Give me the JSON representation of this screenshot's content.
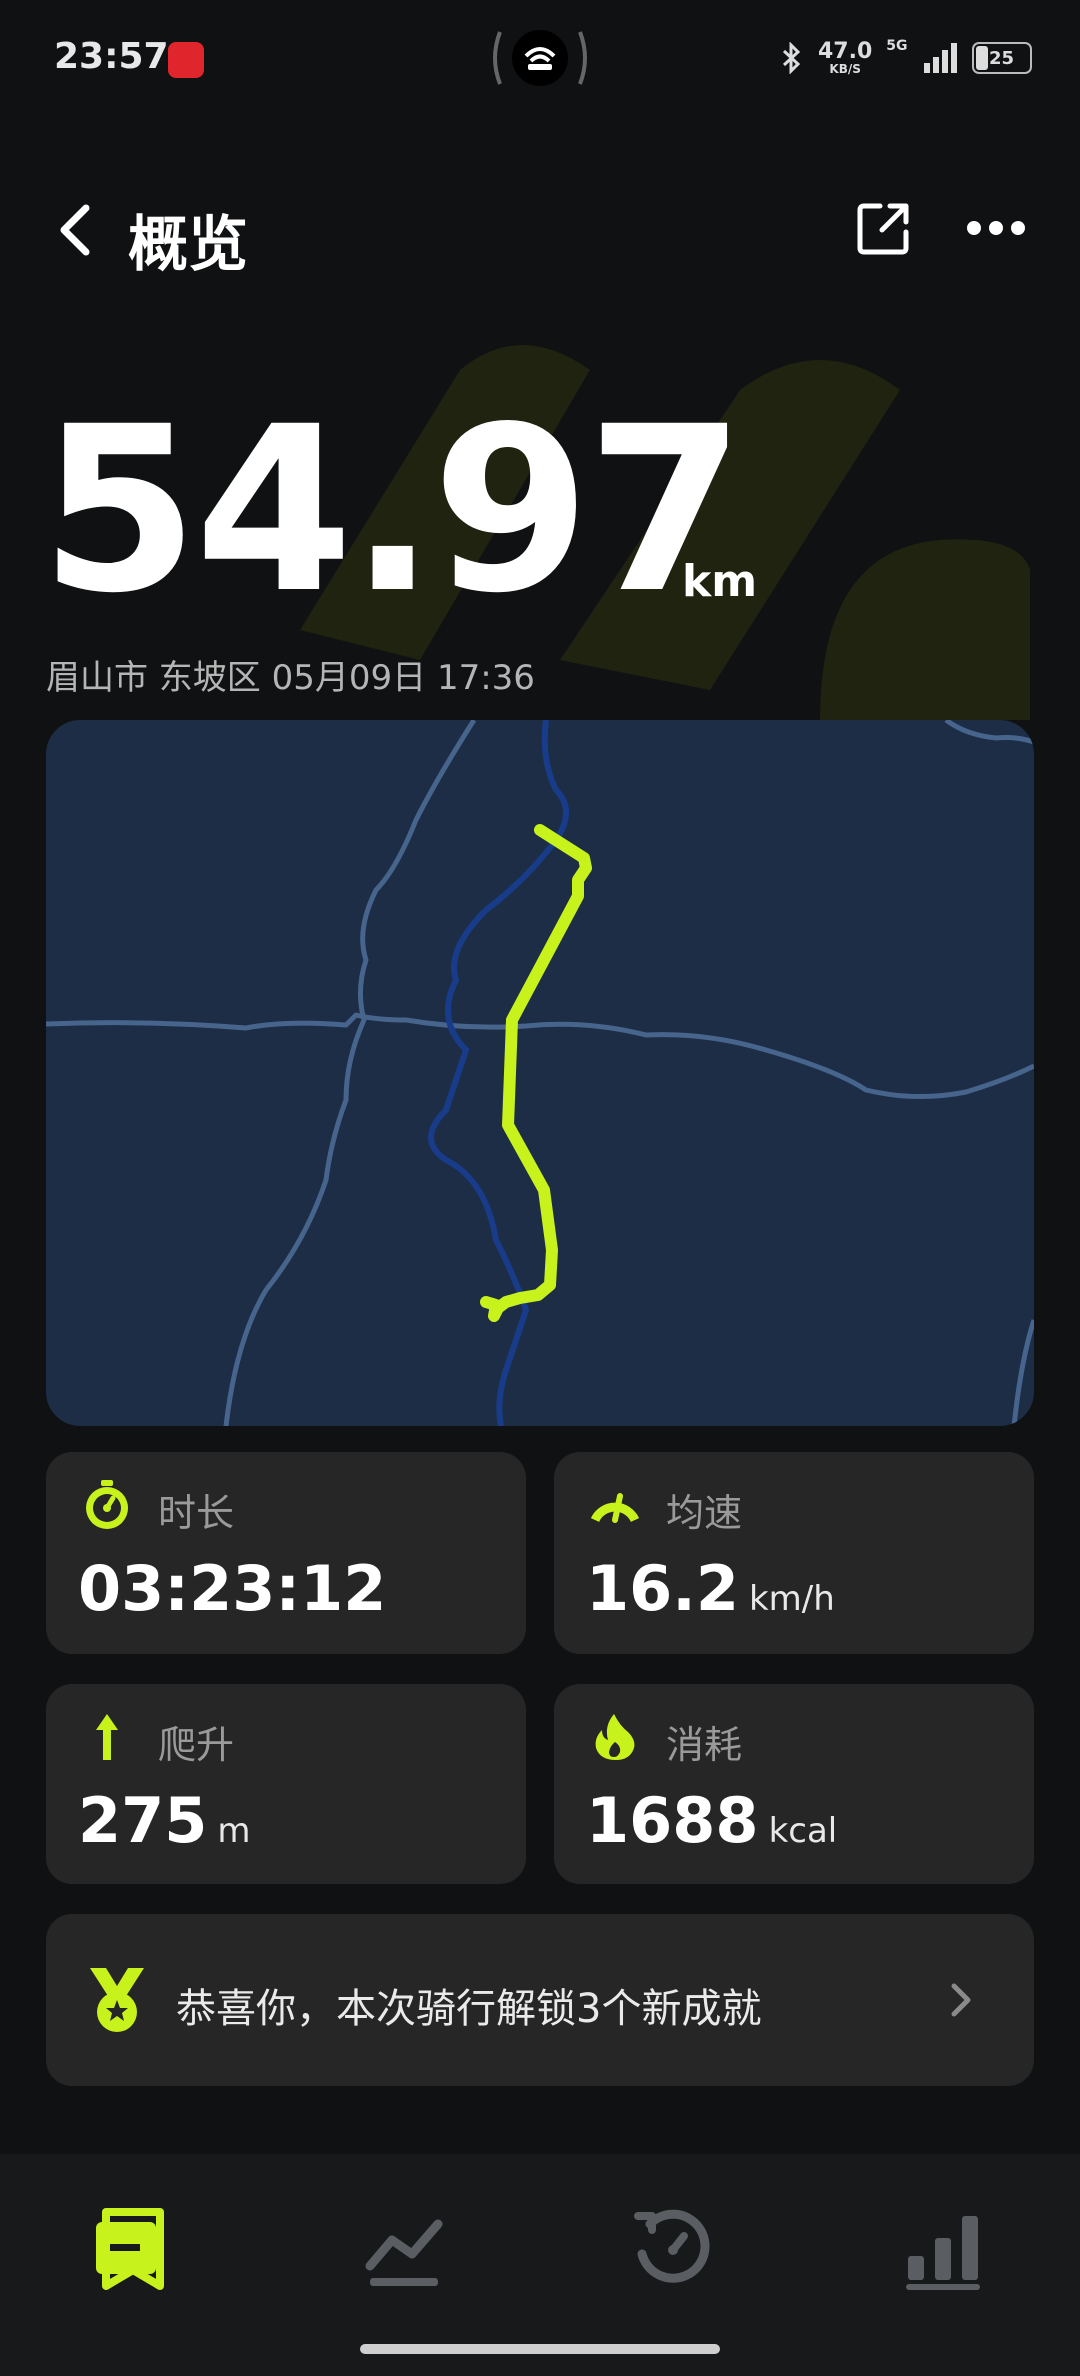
{
  "status_bar": {
    "time": "23:57",
    "net_speed": "47.0",
    "net_speed_unit": "KB/S",
    "network": "5G",
    "battery": "25"
  },
  "header": {
    "title": "概览",
    "back_icon": "chevron-left-icon",
    "share_icon": "share-icon",
    "more_icon": "more-icon"
  },
  "summary": {
    "distance": "54.97",
    "distance_unit": "km",
    "location_date": "眉山市 东坡区  05月09日 17:36"
  },
  "stats": [
    {
      "key": "duration",
      "label": "时长",
      "value": "03:23:12",
      "unit": "",
      "icon": "stopwatch-icon"
    },
    {
      "key": "speed",
      "label": "均速",
      "value": "16.2",
      "unit": "km/h",
      "icon": "speedometer-icon"
    },
    {
      "key": "climb",
      "label": "爬升",
      "value": "275",
      "unit": "m",
      "icon": "arrow-up-icon"
    },
    {
      "key": "calories",
      "label": "消耗",
      "value": "1688",
      "unit": "kcal",
      "icon": "flame-icon"
    }
  ],
  "achievement": {
    "text": "恭喜你，本次骑行解锁3个新成就"
  },
  "bottom_nav": {
    "items": [
      {
        "name": "overview",
        "icon": "overview-icon",
        "active": true
      },
      {
        "name": "trend",
        "icon": "trend-icon",
        "active": false
      },
      {
        "name": "history",
        "icon": "history-icon",
        "active": false
      },
      {
        "name": "stats",
        "icon": "bar-chart-icon",
        "active": false
      }
    ]
  },
  "colors": {
    "accent": "#c8f21c",
    "background": "#0f1113",
    "card": "#262626",
    "map": "#1c2d45"
  }
}
